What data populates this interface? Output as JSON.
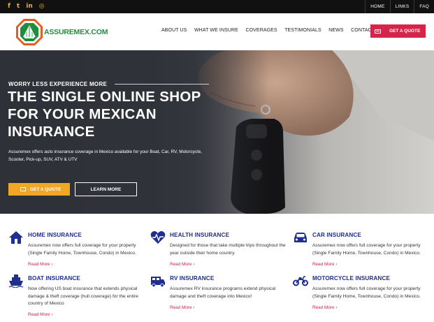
{
  "topbar": {
    "social": [
      {
        "icon": "facebook-icon",
        "glyph": "f"
      },
      {
        "icon": "twitter-icon",
        "glyph": "t"
      },
      {
        "icon": "linkedin-icon",
        "glyph": "in"
      },
      {
        "icon": "instagram-icon",
        "glyph": "◎"
      }
    ],
    "links": [
      "HOME",
      "LINKS",
      "FAQ"
    ]
  },
  "header": {
    "logo_text": "ASSUREMEX.COM",
    "nav": [
      "ABOUT US",
      "WHAT WE INSURE",
      "COVERAGES",
      "TESTIMONIALS",
      "NEWS",
      "CONTACT US"
    ],
    "quote_button": "GET A QUOTE"
  },
  "hero": {
    "eyebrow": "WORRY LESS EXPERIENCE MORE",
    "title": "THE SINGLE ONLINE SHOP FOR YOUR MEXICAN INSURANCE",
    "subtitle": "Assuremex offers auto insurance coverage in Mexico available for your Boat, Car, RV, Motorcycle, Scooter, Pick-up, SUV, ATV & UTV",
    "quote_button": "GET A QUOTE",
    "more_button": "LEARN MORE"
  },
  "services": [
    {
      "title": "HOME INSURANCE",
      "icon": "house-icon",
      "desc": "Assuremex now offers full coverage for your property (Single Family Home, Townhouse, Condo) in Mexico.",
      "more": "Read More ›"
    },
    {
      "title": "HEALTH INSURANCE",
      "icon": "heartbeat-icon",
      "desc": "Designed for those that take multiple trips throughout the year outside their home country.",
      "more": "Read More ›"
    },
    {
      "title": "CAR INSURANCE",
      "icon": "car-icon",
      "desc": "Assuremex now offers full coverage for your property (Single Family Home, Townhouse, Condo) in Mexico.",
      "more": "Read More ›"
    },
    {
      "title": "BOAT INSURANCE",
      "icon": "boat-icon",
      "desc": "Now offering US boat insurance that extends physical damage & theft coverage (hull coverage) for the entire country of Mexico",
      "more": "Read More ›"
    },
    {
      "title": "RV INSURANCE",
      "icon": "rv-icon",
      "desc": "Assuremex RV insurance programs extend physical damage and theft coverage into Mexico!",
      "more": "Read More ›"
    },
    {
      "title": "MOTORCYCLE INSURANCE",
      "icon": "motorcycle-icon",
      "desc": "Assuremex now offers full coverage for your property (Single Family Home, Townhouse, Condo) in Mexico.",
      "more": "Read More ›"
    }
  ],
  "colors": {
    "accent_red": "#d6254a",
    "accent_orange": "#f2a626",
    "title_blue": "#1f2e8f",
    "logo_green": "#1d8f3c"
  }
}
